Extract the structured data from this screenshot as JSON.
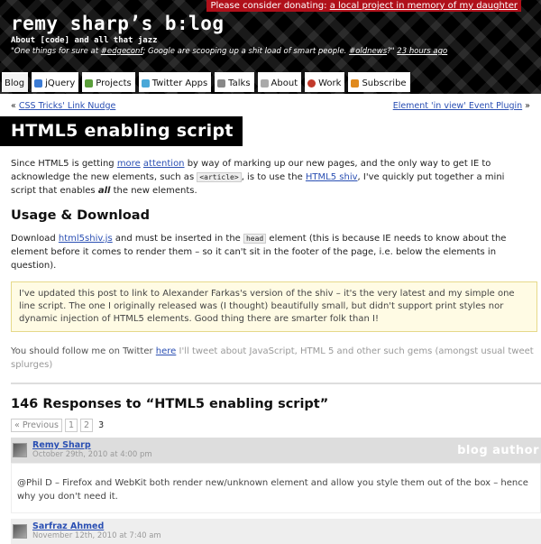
{
  "header": {
    "donate_text": "Please consider donating:",
    "donate_link": "a local project in memory of my daughter",
    "site_title": "remy sharp’s b:log",
    "tagline": "About [code] and all that jazz",
    "tweet_pre": "\"One things for sure at ",
    "tweet_link1": "#edgeconf",
    "tweet_mid": "; Google are scooping up a shit load of smart people. ",
    "tweet_link2": "#oldnews",
    "tweet_post": "?\"",
    "tweet_time": "23 hours ago"
  },
  "nav": [
    {
      "label": "Blog",
      "color": "#ffffff"
    },
    {
      "label": "jQuery",
      "color": "#3b7bd4"
    },
    {
      "label": "Projects",
      "color": "#5a9e3a"
    },
    {
      "label": "Twitter Apps",
      "color": "#4aa8d8"
    },
    {
      "label": "Talks",
      "color": "#888888"
    },
    {
      "label": "About",
      "color": "#aaaaaa"
    },
    {
      "label": "Work",
      "color": "#c23a2b"
    },
    {
      "label": "Subscribe",
      "color": "#e08a1e"
    }
  ],
  "post_nav": {
    "prev": "CSS Tricks' Link Nudge",
    "next": "Element 'in view' Event Plugin"
  },
  "post": {
    "title": "HTML5 enabling script",
    "intro_1": "Since HTML5 is getting ",
    "intro_link_more": "more",
    "intro_2": " ",
    "intro_link_attention": "attention",
    "intro_3": " by way of marking up our new pages, and the only way to get IE to acknowledge the new elements, such as ",
    "intro_code": "<article>",
    "intro_4": ", is to use the ",
    "intro_link_shiv": "HTML5 shiv",
    "intro_5": ", I've quickly put together a mini script that enables ",
    "intro_all": "all",
    "intro_6": " the new elements.",
    "usage_heading": "Usage & Download",
    "dl_1": "Download ",
    "dl_link": "html5shiv.js",
    "dl_2": " and must be inserted in the ",
    "dl_code": "head",
    "dl_3": " element (this is because IE needs to know about the element before it comes to render them – so it can't sit in the footer of the page, i.e. below the elements in question).",
    "update_text": "I've updated this post to link to Alexander Farkas's version of the shiv – it's the very latest and my simple one line script. The one I originally released was (I thought) beautifully small, but didn't support print styles nor dynamic injection of HTML5 elements. Good thing there are smarter folk than I!",
    "follow_1": "You should follow me on Twitter ",
    "follow_link": "here",
    "follow_2": " I'll tweet about JavaScript, HTML 5 and other such gems (amongst usual tweet splurges)"
  },
  "responses": {
    "heading": "146 Responses to “HTML5 enabling script”",
    "prev": "« Previous",
    "pages": [
      "1",
      "2"
    ],
    "current": "3"
  },
  "comments": [
    {
      "author": "Remy Sharp",
      "date": "October 29th, 2010 at 4:00 pm",
      "badge": "blog author",
      "body": "@Phil D – Firefox and WebKit both render new/unknown element and allow you style them out of the box – hence why you don't need it."
    },
    {
      "author": "Sarfraz Ahmed",
      "date": "November 12th, 2010 at 7:40 am"
    }
  ]
}
